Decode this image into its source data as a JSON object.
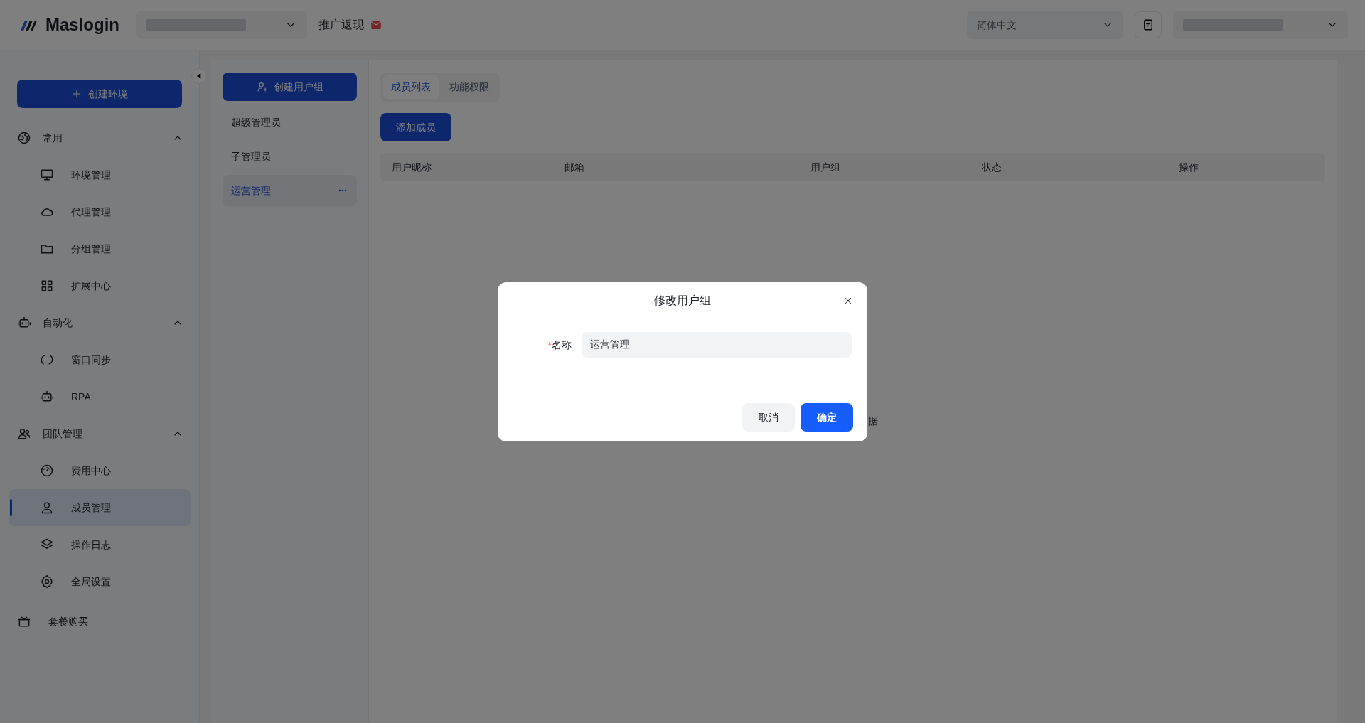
{
  "header": {
    "logo": "Maslogin",
    "promo": "推广返现",
    "language": "简体中文"
  },
  "sidebar": {
    "create_button": "创建环境",
    "sections": [
      {
        "label": "常用",
        "expanded": true,
        "items": [
          {
            "label": "环境管理",
            "selected": false
          },
          {
            "label": "代理管理",
            "selected": false
          },
          {
            "label": "分组管理",
            "selected": false
          },
          {
            "label": "扩展中心",
            "selected": false
          }
        ]
      },
      {
        "label": "自动化",
        "expanded": true,
        "items": [
          {
            "label": "窗口同步",
            "selected": false
          },
          {
            "label": "RPA",
            "selected": false
          }
        ]
      },
      {
        "label": "团队管理",
        "expanded": true,
        "items": [
          {
            "label": "费用中心",
            "selected": false
          },
          {
            "label": "成员管理",
            "selected": true
          },
          {
            "label": "操作日志",
            "selected": false
          },
          {
            "label": "全局设置",
            "selected": false
          }
        ]
      }
    ],
    "bottom_item": "套餐购买"
  },
  "groups": {
    "create_button": "创建用户组",
    "items": [
      {
        "label": "超级管理员",
        "selected": false
      },
      {
        "label": "子管理员",
        "selected": false
      },
      {
        "label": "运营管理",
        "selected": true
      }
    ]
  },
  "content": {
    "tabs": [
      {
        "label": "成员列表",
        "selected": true
      },
      {
        "label": "功能权限",
        "selected": false
      }
    ],
    "add_button": "添加成员",
    "table": {
      "columns": [
        "用户昵称",
        "邮箱",
        "用户组",
        "状态",
        "操作"
      ]
    },
    "empty_text": "据"
  },
  "dialog": {
    "title": "修改用户组",
    "field": {
      "label": "名称",
      "required_mark": "*",
      "value": "运营管理"
    },
    "buttons": {
      "cancel": "取消",
      "confirm": "确定"
    }
  }
}
